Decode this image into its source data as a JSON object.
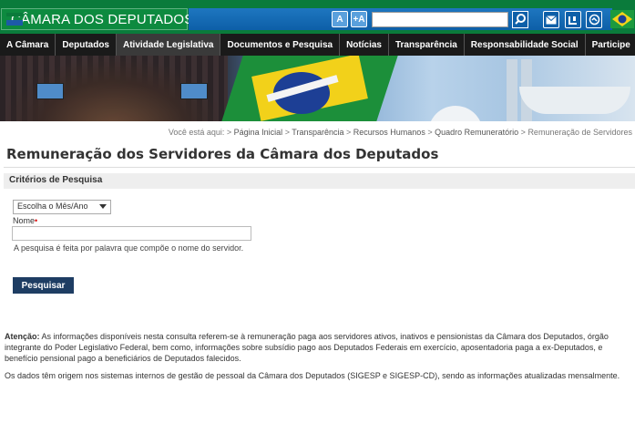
{
  "header": {
    "logo_text": "CÂMARA DOS DEPUTADOS",
    "font_minus": "A",
    "font_plus": "+A",
    "search_value": "",
    "icons": [
      "search-icon",
      "mail-icon",
      "accessibility-icon",
      "sign-language-icon",
      "brazil-flag-icon"
    ]
  },
  "nav": {
    "items": [
      {
        "label": "A Câmara"
      },
      {
        "label": "Deputados"
      },
      {
        "label": "Atividade Legislativa"
      },
      {
        "label": "Documentos e Pesquisa"
      },
      {
        "label": "Notícias"
      },
      {
        "label": "Transparência"
      },
      {
        "label": "Responsabilidade Social"
      },
      {
        "label": "Participe"
      }
    ]
  },
  "breadcrumb": {
    "prefix": "Você está aqui:",
    "items": [
      "Página Inicial",
      "Transparência",
      "Recursos Humanos",
      "Quadro Remuneratório",
      "Remuneração de Servidores"
    ]
  },
  "page": {
    "title": "Remuneração dos Servidores da Câmara dos Deputados",
    "criteria_title": "Critérios de Pesquisa",
    "select_value": "Escolha o Mês/Ano",
    "name_label": "Nome",
    "name_required_mark": "•",
    "name_value": "",
    "hint": "A pesquisa é feita por palavra que compõe o nome do servidor.",
    "search_button": "Pesquisar"
  },
  "notice": {
    "label": "Atenção:",
    "text": "As informações disponíveis nesta consulta referem-se à remuneração paga aos servidores ativos, inativos e pensionistas da Câmara dos Deputados, órgão integrante do Poder Legislativo Federal, bem como, informações sobre subsídio pago aos Deputados Federais em exercício, aposentadoria paga a ex-Deputados, e benefício pensional pago a beneficiários de Deputados falecidos.",
    "origin": "Os dados têm origem nos sistemas internos de gestão de pessoal da Câmara dos Deputados (SIGESP e SIGESP-CD), sendo as informações atualizadas mensalmente."
  },
  "colors": {
    "header_green": "#0a7b3b",
    "header_blue": "#0d5fa8",
    "nav_bg": "#1a1a1a",
    "button_blue": "#1e3d63"
  }
}
